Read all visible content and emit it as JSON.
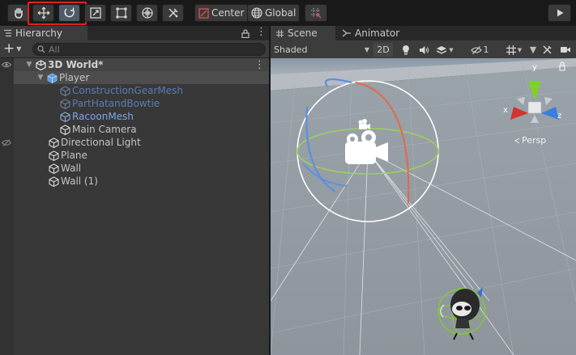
{
  "toolbar": {
    "tools": [
      {
        "name": "hand",
        "icon": "hand-icon"
      },
      {
        "name": "move",
        "icon": "move-icon"
      },
      {
        "name": "rotate",
        "icon": "rotate-icon"
      },
      {
        "name": "scale",
        "icon": "scale-icon"
      },
      {
        "name": "rect",
        "icon": "rect-transform-icon"
      },
      {
        "name": "transform",
        "icon": "transform-icon"
      },
      {
        "name": "custom",
        "icon": "custom-tools-icon"
      }
    ],
    "pivot_label": "Center",
    "space_label": "Global",
    "highlight_color": "#e0221b"
  },
  "hierarchy": {
    "tab_label": "Hierarchy",
    "search_placeholder": "All",
    "scene_name": "3D World*",
    "items": [
      {
        "label": "Player"
      },
      {
        "label": "ConstructionGearMesh"
      },
      {
        "label": "PartHatandBowtie"
      },
      {
        "label": "RacoonMesh"
      },
      {
        "label": "Main Camera"
      },
      {
        "label": "Directional Light"
      },
      {
        "label": "Plane"
      },
      {
        "label": "Wall"
      },
      {
        "label": "Wall (1)"
      }
    ]
  },
  "scene": {
    "tab_scene": "Scene",
    "tab_animator": "Animator",
    "shading_mode": "Shaded",
    "mode_2d": "2D",
    "hidden_count": "1",
    "gizmo_axes": {
      "x": "x",
      "y": "y",
      "z": "z"
    },
    "projection": "Persp"
  }
}
